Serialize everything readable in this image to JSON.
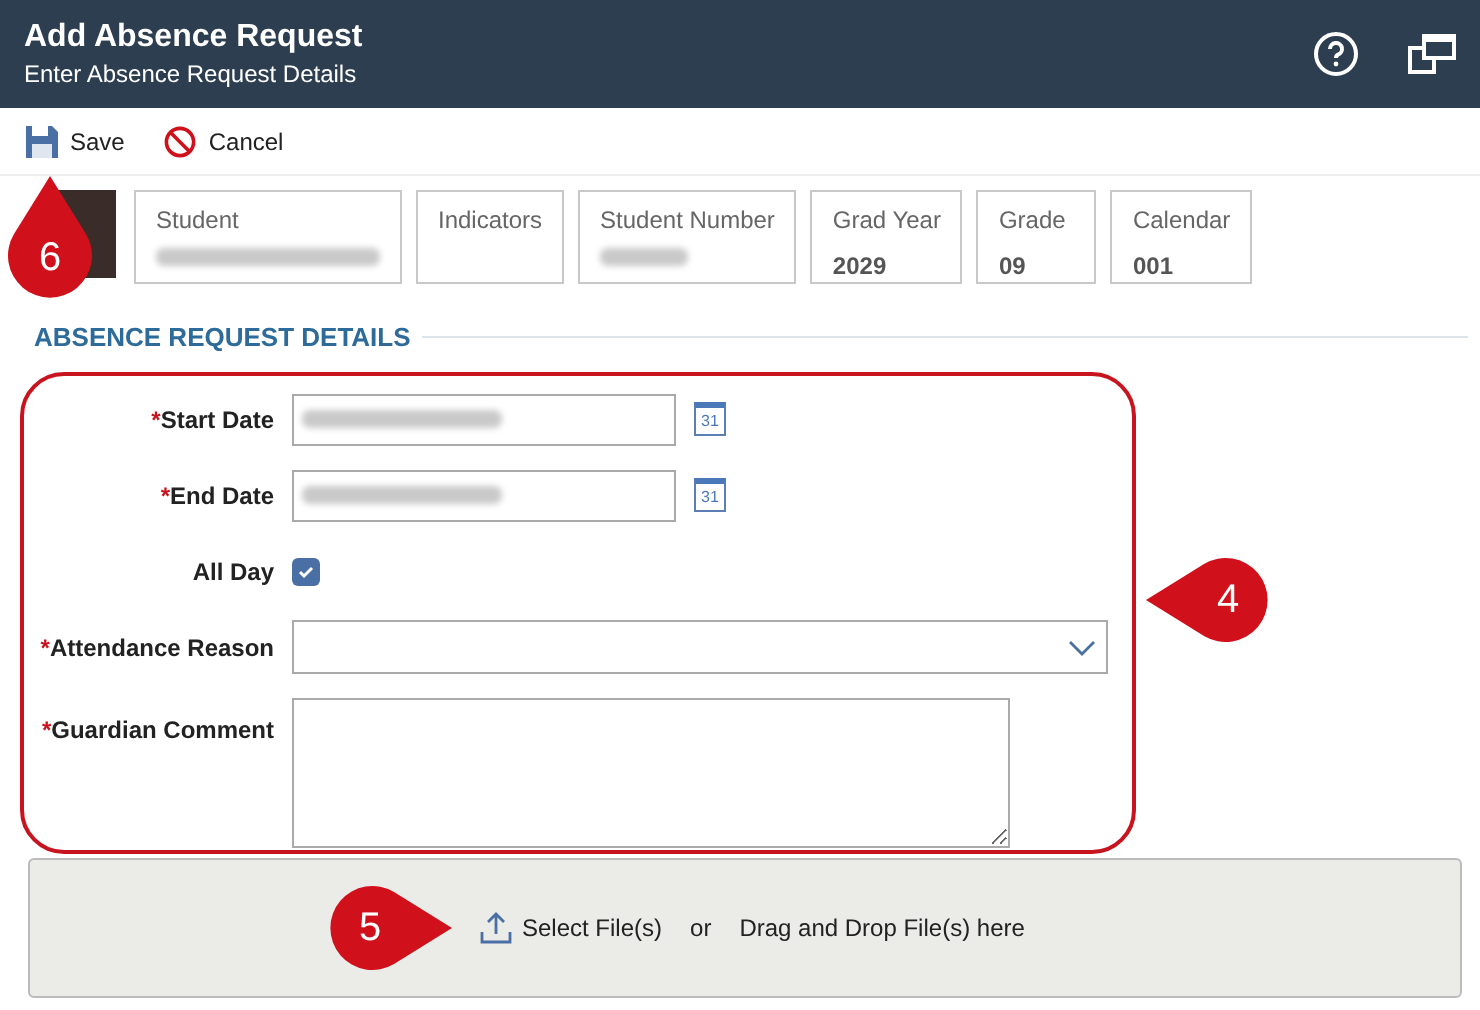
{
  "window": {
    "title": "Add Absence Request",
    "subtitle": "Enter Absence Request Details"
  },
  "toolbar": [
    {
      "kind": "save",
      "label": "Save"
    },
    {
      "kind": "cancel",
      "label": "Cancel"
    }
  ],
  "student_cards": [
    {
      "label": "Student",
      "redacted": true
    },
    {
      "label": "Indicators",
      "redacted": false
    },
    {
      "label": "Student Number",
      "redacted": true
    },
    {
      "label": "Grad Year",
      "value": "2029",
      "redacted": false
    },
    {
      "label": "Grade",
      "value": "09",
      "redacted": false
    },
    {
      "label": "Calendar",
      "value": "001",
      "redacted": false
    }
  ],
  "section": {
    "title": "ABSENCE REQUEST DETAILS"
  },
  "fields": [
    {
      "kind": "date",
      "required_mark": "*",
      "label": "Start Date",
      "redacted": true,
      "calendar_day": "31"
    },
    {
      "kind": "date",
      "required_mark": "*",
      "label": "End Date",
      "redacted": true,
      "calendar_day": "31"
    },
    {
      "kind": "checkbox",
      "label": "All Day",
      "checked": true
    },
    {
      "kind": "select",
      "required_mark": "*",
      "label": "Attendance Reason"
    },
    {
      "kind": "textarea",
      "required_mark": "*",
      "label": "Guardian Comment"
    }
  ],
  "upload": {
    "select_label": "Select File(s)",
    "separator": "or",
    "drop_label": "Drag and Drop File(s) here"
  },
  "callouts": [
    {
      "number": "6",
      "kind": "up"
    },
    {
      "number": "4",
      "kind": "left"
    },
    {
      "number": "5",
      "kind": "right"
    }
  ]
}
